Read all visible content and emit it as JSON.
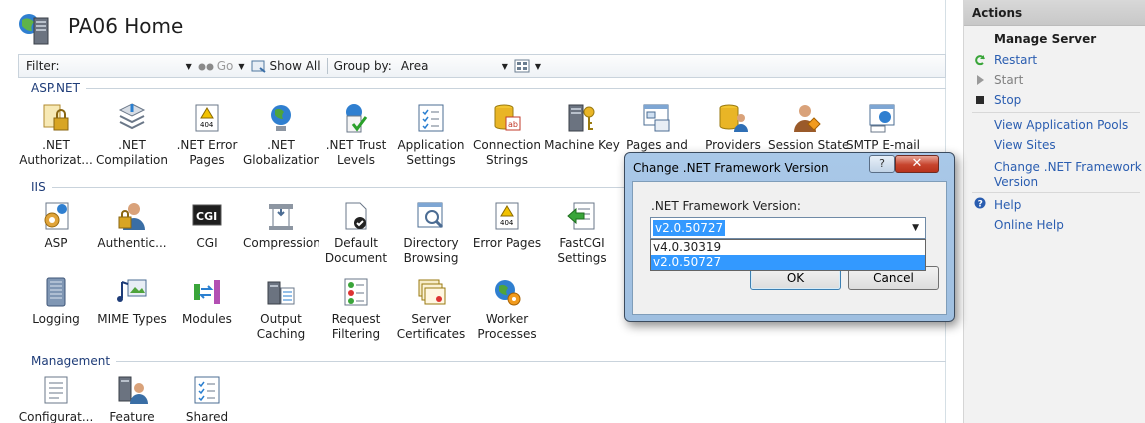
{
  "page": {
    "title": "PA06 Home"
  },
  "filterbar": {
    "filter_label": "Filter:",
    "go_label": "Go",
    "show_all_label": "Show All",
    "group_by_label": "Group by:",
    "group_by_value": "Area"
  },
  "sections": {
    "aspnet": "ASP.NET",
    "iis": "IIS",
    "management": "Management"
  },
  "aspnet_tiles": [
    {
      "line1": ".NET",
      "line2": "Authorizat..."
    },
    {
      "line1": ".NET",
      "line2": "Compilation"
    },
    {
      "line1": ".NET Error",
      "line2": "Pages"
    },
    {
      "line1": ".NET",
      "line2": "Globalization"
    },
    {
      "line1": ".NET Trust",
      "line2": "Levels"
    },
    {
      "line1": "Application",
      "line2": "Settings"
    },
    {
      "line1": "Connection",
      "line2": "Strings"
    },
    {
      "line1": "Machine Key",
      "line2": ""
    },
    {
      "line1": "Pages and",
      "line2": ""
    },
    {
      "line1": "Providers",
      "line2": ""
    },
    {
      "line1": "Session State",
      "line2": ""
    },
    {
      "line1": "SMTP E-mail",
      "line2": ""
    }
  ],
  "iis_tiles": [
    {
      "line1": "ASP",
      "line2": ""
    },
    {
      "line1": "Authentic...",
      "line2": ""
    },
    {
      "line1": "CGI",
      "line2": ""
    },
    {
      "line1": "Compression",
      "line2": ""
    },
    {
      "line1": "Default",
      "line2": "Document"
    },
    {
      "line1": "Directory",
      "line2": "Browsing"
    },
    {
      "line1": "Error Pages",
      "line2": ""
    },
    {
      "line1": "FastCGI",
      "line2": "Settings"
    },
    {
      "line1": "Logging",
      "line2": ""
    },
    {
      "line1": "MIME Types",
      "line2": ""
    },
    {
      "line1": "Modules",
      "line2": ""
    },
    {
      "line1": "Output",
      "line2": "Caching"
    },
    {
      "line1": "Request",
      "line2": "Filtering"
    },
    {
      "line1": "Server",
      "line2": "Certificates"
    },
    {
      "line1": "Worker",
      "line2": "Processes"
    }
  ],
  "management_tiles": [
    {
      "line1": "Configurat...",
      "line2": ""
    },
    {
      "line1": "Feature",
      "line2": ""
    },
    {
      "line1": "Shared",
      "line2": ""
    }
  ],
  "actions": {
    "title": "Actions",
    "manage_server": "Manage Server",
    "restart": "Restart",
    "start": "Start",
    "stop": "Stop",
    "view_app_pools": "View Application Pools",
    "view_sites": "View Sites",
    "change_fw_line1": "Change .NET Framework",
    "change_fw_line2": "Version",
    "help": "Help",
    "online_help": "Online Help"
  },
  "dialog": {
    "title": "Change .NET Framework Version",
    "help_glyph": "?",
    "close_glyph": "✕",
    "field_label": ".NET Framework Version:",
    "selected_value": "v2.0.50727",
    "options": [
      "v4.0.30319",
      "v2.0.50727"
    ],
    "ok_label": "OK",
    "cancel_label": "Cancel"
  },
  "colors": {
    "link": "#2a5db0",
    "section": "#1e3c78",
    "selection": "#3399ff"
  }
}
